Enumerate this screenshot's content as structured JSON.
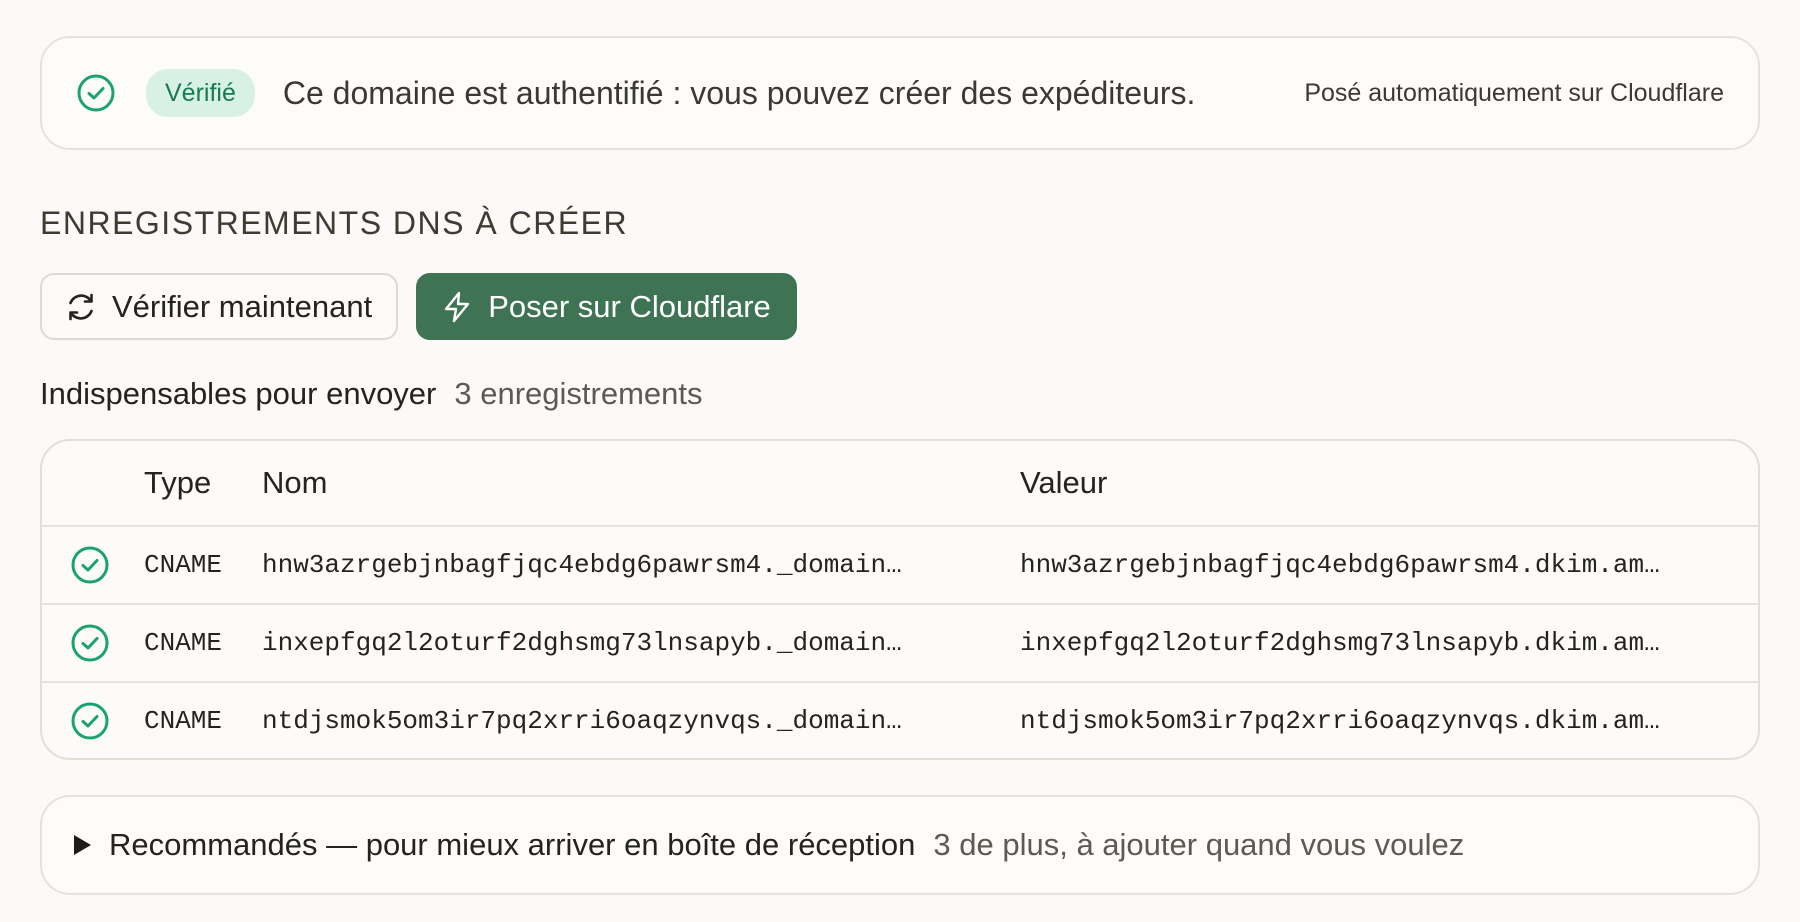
{
  "status": {
    "badge": "Vérifié",
    "message": "Ce domaine est authentifié : vous pouvez créer des expéditeurs.",
    "note": "Posé automatiquement sur Cloudflare"
  },
  "section_title": "ENREGISTREMENTS DNS À CRÉER",
  "actions": {
    "verify_label": "Vérifier maintenant",
    "cloudflare_label": "Poser sur Cloudflare"
  },
  "group": {
    "label": "Indispensables pour envoyer",
    "count": "3 enregistrements"
  },
  "table": {
    "headers": {
      "type": "Type",
      "name": "Nom",
      "value": "Valeur"
    },
    "rows": [
      {
        "type": "CNAME",
        "name": "hnw3azrgebjnbagfjqc4ebdg6pawrsm4._domain…",
        "value": "hnw3azrgebjnbagfjqc4ebdg6pawrsm4.dkim.am…"
      },
      {
        "type": "CNAME",
        "name": "inxepfgq2l2oturf2dghsmg73lnsapyb._domain…",
        "value": "inxepfgq2l2oturf2dghsmg73lnsapyb.dkim.am…"
      },
      {
        "type": "CNAME",
        "name": "ntdjsmok5om3ir7pq2xrri6oaqzynvqs._domain…",
        "value": "ntdjsmok5om3ir7pq2xrri6oaqzynvqs.dkim.am…"
      }
    ]
  },
  "recommended": {
    "title": "Recommandés — pour mieux arriver en boîte de réception",
    "subtitle": "3 de plus, à ajouter quand vous voulez"
  },
  "colors": {
    "accent_green": "#3e7353",
    "check_green": "#1aa36f",
    "badge_bg": "#d8f1e5"
  },
  "icons": {
    "status": "check-circle-icon",
    "verify": "refresh-icon",
    "cloudflare": "lightning-icon",
    "row_status": "check-circle-icon",
    "expand": "triangle-right-icon"
  }
}
